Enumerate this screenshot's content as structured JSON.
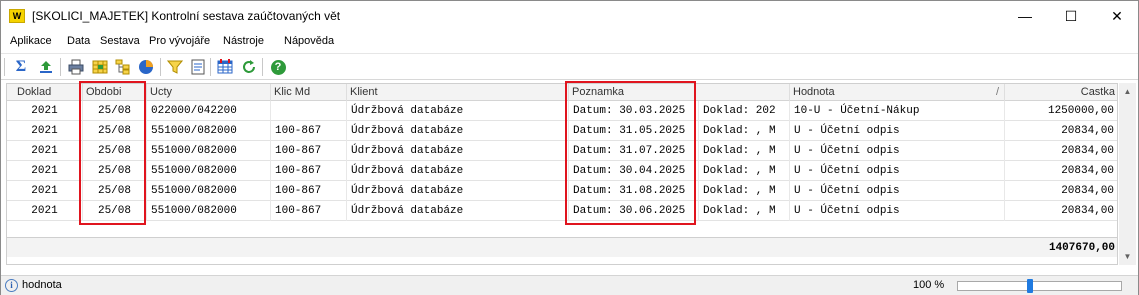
{
  "window": {
    "logo": "W",
    "title": "[SKOLICI_MAJETEK] Kontrolní sestava zaúčtovaných vět",
    "minimize": "—",
    "maximize": "☐",
    "close": "✕"
  },
  "menu": [
    "Aplikace",
    "Data",
    "Sestava",
    "Pro vývojáře",
    "Nástroje",
    "Nápověda"
  ],
  "toolbar": {
    "icons": [
      "sum-icon",
      "export-icon",
      "print-icon",
      "grid-icon",
      "tree-icon",
      "pie-chart-icon",
      "filter-icon",
      "report-icon",
      "table-settings-icon",
      "refresh-icon",
      "help-icon"
    ],
    "help_glyph": "?",
    "sum_glyph": "Σ"
  },
  "grid": {
    "columns": [
      "Doklad",
      "Obdobi",
      "Ucty",
      "Klic Md",
      "Klient",
      "Poznamka",
      "Hodnota",
      "Castka"
    ],
    "sort_marker": "/",
    "rows": [
      {
        "doklad": "2021",
        "obdobi": "25/08",
        "ucty": "022000/042200",
        "klic": "",
        "klient": "Údržbová databáze",
        "poznamka": "Datum: 30.03.2025",
        "poznamka2": "Doklad: 202",
        "hodnota": "10-U - Účetní-Nákup",
        "castka": "1250000,00"
      },
      {
        "doklad": "2021",
        "obdobi": "25/08",
        "ucty": "551000/082000",
        "klic": "100-867",
        "klient": "Údržbová databáze",
        "poznamka": "Datum: 31.05.2025",
        "poznamka2": "Doklad: , M",
        "hodnota": "U - Účetní odpis",
        "castka": "20834,00"
      },
      {
        "doklad": "2021",
        "obdobi": "25/08",
        "ucty": "551000/082000",
        "klic": "100-867",
        "klient": "Údržbová databáze",
        "poznamka": "Datum: 31.07.2025",
        "poznamka2": "Doklad: , M",
        "hodnota": "U - Účetní odpis",
        "castka": "20834,00"
      },
      {
        "doklad": "2021",
        "obdobi": "25/08",
        "ucty": "551000/082000",
        "klic": "100-867",
        "klient": "Údržbová databáze",
        "poznamka": "Datum: 30.04.2025",
        "poznamka2": "Doklad: , M",
        "hodnota": "U - Účetní odpis",
        "castka": "20834,00"
      },
      {
        "doklad": "2021",
        "obdobi": "25/08",
        "ucty": "551000/082000",
        "klic": "100-867",
        "klient": "Údržbová databáze",
        "poznamka": "Datum: 31.08.2025",
        "poznamka2": "Doklad: , M",
        "hodnota": "U - Účetní odpis",
        "castka": "20834,00"
      },
      {
        "doklad": "2021",
        "obdobi": "25/08",
        "ucty": "551000/082000",
        "klic": "100-867",
        "klient": "Údržbová databáze",
        "poznamka": "Datum: 30.06.2025",
        "poznamka2": "Doklad: , M",
        "hodnota": "U - Účetní odpis",
        "castka": "20834,00"
      }
    ],
    "total": "1407670,00"
  },
  "scrollbar": {
    "up": "▲",
    "down": "▼"
  },
  "status": {
    "icon": "i",
    "text": "hodnota",
    "zoom": "100 %",
    "zoom_level": 1.0
  },
  "colors": {
    "highlight": "#e0141e",
    "zoom_thumb": "#1f7ae0"
  }
}
